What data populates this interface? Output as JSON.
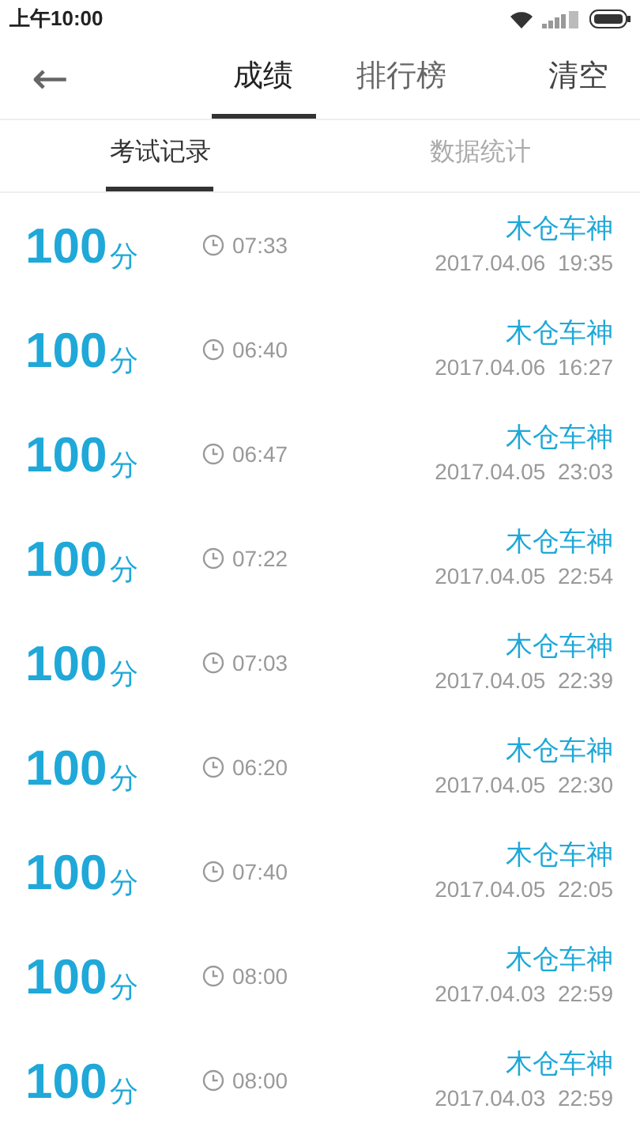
{
  "status_bar": {
    "time": "上午10:00"
  },
  "header": {
    "back": "←",
    "tabs": [
      {
        "label": "成绩",
        "selected": true
      },
      {
        "label": "排行榜",
        "selected": false
      }
    ],
    "action": "清空"
  },
  "sub_tabs": [
    {
      "label": "考试记录",
      "selected": true
    },
    {
      "label": "数据统计",
      "selected": false
    }
  ],
  "records": [
    {
      "score": "100",
      "unit": "分",
      "duration": "07:33",
      "name": "木仓车神",
      "date": "2017.04.06  19:35"
    },
    {
      "score": "100",
      "unit": "分",
      "duration": "06:40",
      "name": "木仓车神",
      "date": "2017.04.06  16:27"
    },
    {
      "score": "100",
      "unit": "分",
      "duration": "06:47",
      "name": "木仓车神",
      "date": "2017.04.05  23:03"
    },
    {
      "score": "100",
      "unit": "分",
      "duration": "07:22",
      "name": "木仓车神",
      "date": "2017.04.05  22:54"
    },
    {
      "score": "100",
      "unit": "分",
      "duration": "07:03",
      "name": "木仓车神",
      "date": "2017.04.05  22:39"
    },
    {
      "score": "100",
      "unit": "分",
      "duration": "06:20",
      "name": "木仓车神",
      "date": "2017.04.05  22:30"
    },
    {
      "score": "100",
      "unit": "分",
      "duration": "07:40",
      "name": "木仓车神",
      "date": "2017.04.05  22:05"
    },
    {
      "score": "100",
      "unit": "分",
      "duration": "08:00",
      "name": "木仓车神",
      "date": "2017.04.03  22:59"
    },
    {
      "score": "100",
      "unit": "分",
      "duration": "08:00",
      "name": "木仓车神",
      "date": "2017.04.03  22:59"
    }
  ]
}
